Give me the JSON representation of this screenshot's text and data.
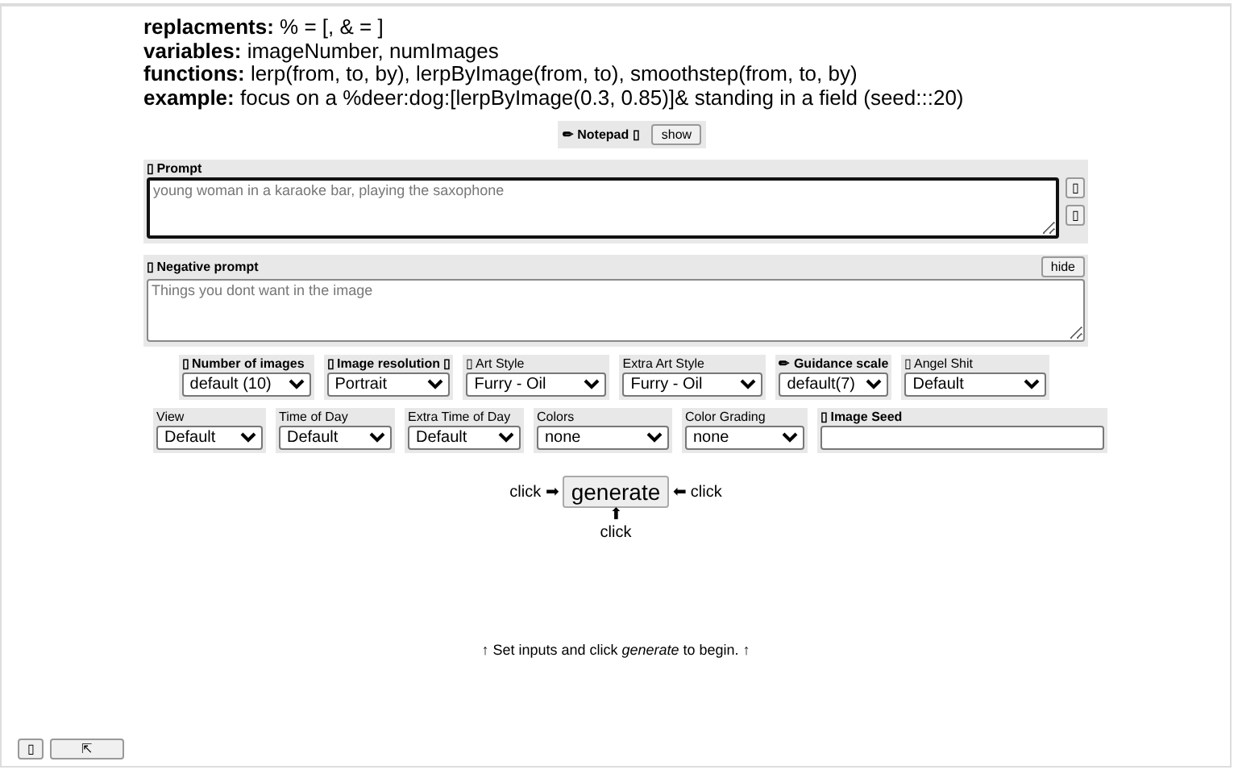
{
  "help_lines": [
    "**replacments:** % = [, & = ]",
    "**variables:** imageNumber, numImages",
    "**functions:** lerp(from, to, by), lerpByImage(from, to), smoothstep(from, to, by)",
    "**example:** focus on a %deer:dog:[lerpByImage(0.3, 0.85)]& standing in a field (seed:::20)"
  ],
  "notepad": {
    "label": "✏ Notepad ▯",
    "button": "show"
  },
  "prompt": {
    "label": "▯ Prompt",
    "placeholder": "young woman in a karaoke bar, playing the saxophone",
    "side_buttons": [
      "▯",
      "▯"
    ]
  },
  "negative_prompt": {
    "label": "▯ Negative prompt",
    "placeholder": "Things you dont want in the image",
    "button": "hide"
  },
  "option_rows": [
    [
      {
        "kind": "select",
        "label": "▯ Number of images",
        "bold": true,
        "value": "default (10)"
      },
      {
        "kind": "select",
        "label": "▯ Image resolution ▯",
        "bold": true,
        "value": "Portrait"
      },
      {
        "kind": "select",
        "label": "▯ Art Style",
        "bold": false,
        "value": "Furry - Oil"
      },
      {
        "kind": "select",
        "label": "Extra Art Style",
        "bold": false,
        "value": "Furry - Oil"
      },
      {
        "kind": "select",
        "label": "✏ Guidance scale",
        "bold": true,
        "value": "default(7)"
      },
      {
        "kind": "select",
        "label": "▯ Angel Shit",
        "bold": false,
        "value": "Default"
      }
    ],
    [
      {
        "kind": "select",
        "label": "View",
        "bold": false,
        "value": "Default"
      },
      {
        "kind": "select",
        "label": "Time of Day",
        "bold": false,
        "value": "Default"
      },
      {
        "kind": "select",
        "label": "Extra Time of Day",
        "bold": false,
        "value": "Default"
      },
      {
        "kind": "select",
        "label": "Colors",
        "bold": false,
        "value": "none"
      },
      {
        "kind": "select",
        "label": "Color Grading",
        "bold": false,
        "value": "none"
      },
      {
        "kind": "text",
        "label": "▯ Image Seed",
        "bold": true
      }
    ]
  ],
  "generate": {
    "button": "generate",
    "left": "click ➡",
    "right": "⬅ click",
    "below_arrow": "⬆",
    "below": "click"
  },
  "status": "↑ Set inputs and click *generate* to begin. ↑",
  "corner_buttons": [
    "▯",
    "⇱"
  ]
}
